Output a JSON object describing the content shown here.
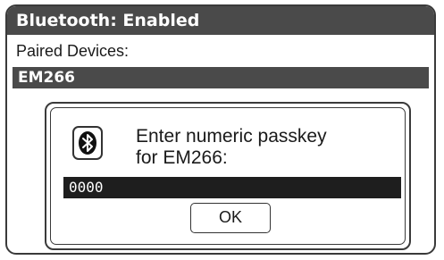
{
  "header": {
    "title": "Bluetooth: Enabled"
  },
  "paired_devices": {
    "label": "Paired Devices:",
    "items": [
      {
        "name": "EM266",
        "selected": true
      }
    ]
  },
  "passkey_dialog": {
    "icon": "bluetooth-icon",
    "prompt_line1": "Enter numeric passkey",
    "prompt_line2": "for EM266:",
    "passkey_value": "0000",
    "ok_label": "OK"
  },
  "colors": {
    "title_bar": "#4a4a4a",
    "selected_row": "#4a4a4a",
    "passkey_field": "#1e1e1e",
    "border": "#3a3a3a"
  }
}
